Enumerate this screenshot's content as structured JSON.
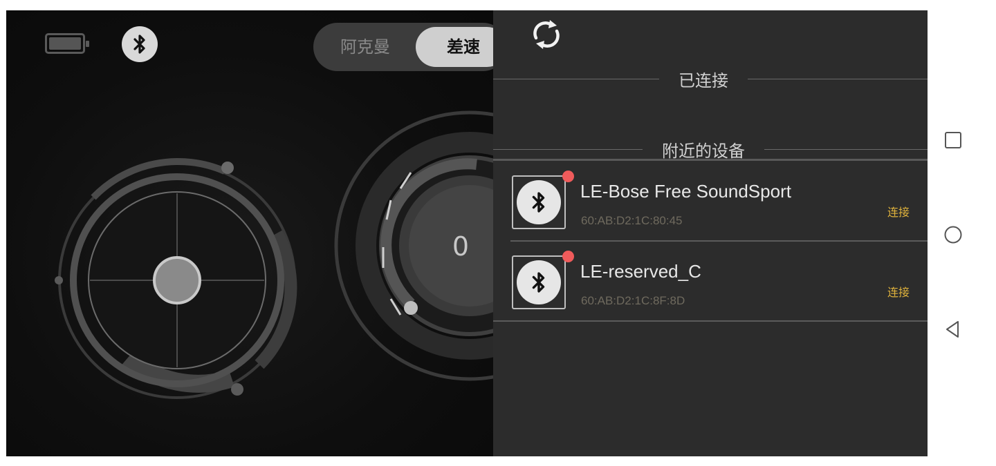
{
  "app": {
    "battery_icon": "battery-icon",
    "bluetooth_icon": "bluetooth-icon",
    "mode_toggle": {
      "option_a": "阿克曼",
      "option_b": "差速",
      "selected": "差速"
    },
    "joystick_icon": "joystick-dial",
    "speed_value": "0"
  },
  "drawer": {
    "refresh_icon": "refresh-icon",
    "connected_section": "已连接",
    "nearby_section": "附近的设备",
    "devices": [
      {
        "name": "LE-Bose Free SoundSport",
        "mac": "60:AB:D2:1C:80:45",
        "action": "连接",
        "icon": "bluetooth-icon"
      },
      {
        "name": "LE-reserved_C",
        "mac": "60:AB:D2:1C:8F:8D",
        "action": "连接",
        "icon": "bluetooth-icon"
      }
    ]
  },
  "navbar": {
    "recent_icon": "square-recent-icon",
    "home_icon": "circle-home-icon",
    "back_icon": "triangle-back-icon"
  },
  "colors": {
    "drawer_bg": "#2c2c2c",
    "connect_accent": "#e0b33c",
    "status_dot": "#ef5b5b"
  }
}
